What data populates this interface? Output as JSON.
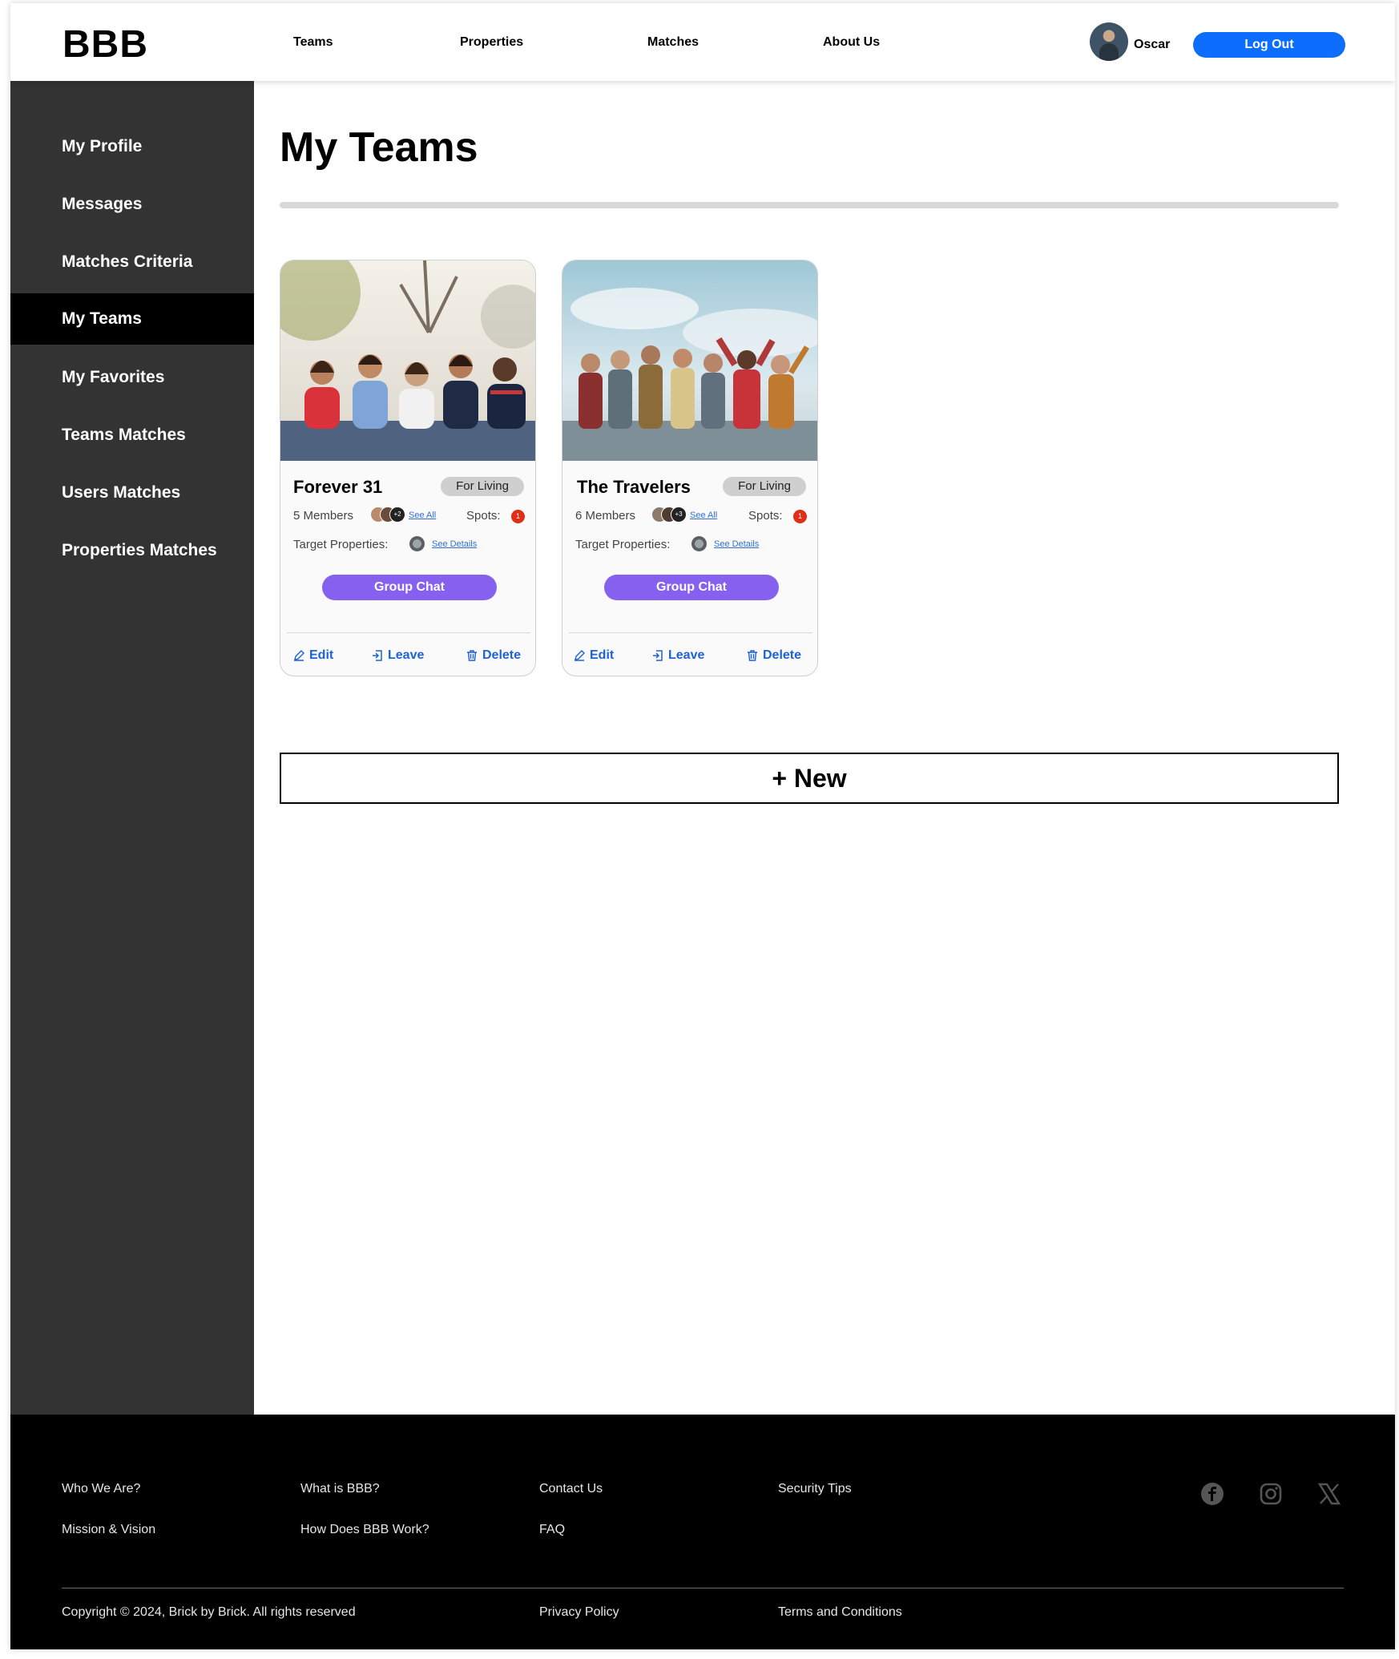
{
  "header": {
    "logo": "BBB",
    "nav": [
      "Teams",
      "Properties",
      "Matches",
      "About Us"
    ],
    "username": "Oscar",
    "logout_label": "Log Out"
  },
  "sidebar": {
    "items": [
      {
        "label": "My Profile",
        "active": false
      },
      {
        "label": "Messages",
        "active": false
      },
      {
        "label": "Matches Criteria",
        "active": false
      },
      {
        "label": "My Teams",
        "active": true
      },
      {
        "label": "My Favorites",
        "active": false
      },
      {
        "label": "Teams Matches",
        "active": false
      },
      {
        "label": "Users Matches",
        "active": false
      },
      {
        "label": "Properties Matches",
        "active": false
      }
    ]
  },
  "main": {
    "title": "My Teams",
    "new_button_label": "+ New"
  },
  "teams": [
    {
      "name": "Forever 31",
      "badge": "For Living",
      "members_text": "5 Members",
      "extra_members": "+2",
      "see_all": "See All",
      "spots_label": "Spots:",
      "spots_count": "1",
      "target_label": "Target Properties:",
      "see_details": "See Details",
      "chat_label": "Group Chat",
      "edit_label": "Edit",
      "leave_label": "Leave",
      "delete_label": "Delete"
    },
    {
      "name": "The Travelers",
      "badge": "For Living",
      "members_text": "6 Members",
      "extra_members": "+3",
      "see_all": "See All",
      "spots_label": "Spots:",
      "spots_count": "1",
      "target_label": "Target Properties:",
      "see_details": "See Details",
      "chat_label": "Group Chat",
      "edit_label": "Edit",
      "leave_label": "Leave",
      "delete_label": "Delete"
    }
  ],
  "footer": {
    "col1": [
      "Who We Are?",
      "Mission & Vision"
    ],
    "col2": [
      "What is BBB?",
      "How Does BBB Work?"
    ],
    "col3": [
      "Contact Us",
      "FAQ"
    ],
    "col4": [
      "Security Tips"
    ],
    "social_icons": [
      "facebook-icon",
      "instagram-icon",
      "x-icon"
    ],
    "copyright": "Copyright © 2024, Brick by Brick. All rights reserved",
    "privacy": "Privacy Policy",
    "terms": "Terms and Conditions"
  },
  "colors": {
    "primary_blue": "#0d6efd",
    "chat_purple": "#8661f0",
    "action_blue": "#1d63d8",
    "sidebar_bg": "#333333",
    "sidebar_active": "#000000",
    "spot_red": "#e22e16"
  }
}
